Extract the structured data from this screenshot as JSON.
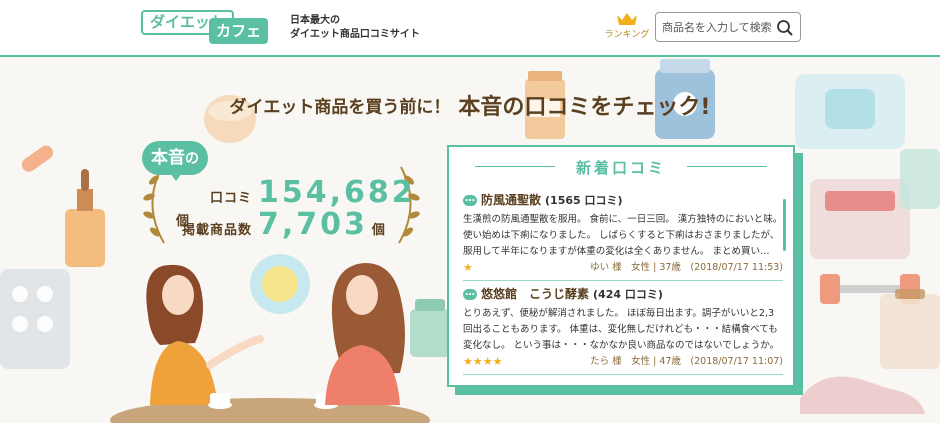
{
  "header": {
    "logo_part1": "ダイエット",
    "logo_part2": "カフェ",
    "tagline_line1": "日本最大の",
    "tagline_line2": "ダイエット商品口コミサイト",
    "ranking_label": "ランキング",
    "search_placeholder": "商品名を入力して検索"
  },
  "hero": {
    "catch_small": "ダイエット商品を買う前に！",
    "catch_large": "本音の口コミをチェック!",
    "bubble_big": "本音",
    "bubble_small": "の",
    "stats": [
      {
        "label": "口コミ",
        "value": "154,682",
        "unit": "個"
      },
      {
        "label": "掲載商品数",
        "value": "7,703",
        "unit": "個"
      }
    ]
  },
  "reviews": {
    "title": "新着口コミ",
    "items": [
      {
        "product": "防風通聖散",
        "count": "(1565 口コミ)",
        "body": "生漢煎の防風通聖散を服用。 食前に、一日三回。 漢方独特のにおいと味。 使い始めは下痢になりました。 しばらくすると下痢はおさまりましたが、服用して半年になりますが体重の変化は全くありません。 まとめ買い…",
        "stars": "★",
        "rating": 1,
        "author": "ゆい 様　女性 | 37歳　(2018/07/17 11:53)"
      },
      {
        "product": "悠悠館　こうじ酵素",
        "count": "(424 口コミ)",
        "body": "とりあえず、便秘が解消されました。 ほぼ毎日出ます。調子がいいと2,3回出ることもあります。 体重は、変化無しだけれども・・・結構食べても変化なし。 という事は・・・なかなか良い商品なのではないでしょうか。",
        "stars": "★★★★",
        "rating": 4,
        "author": "たら 様　女性 | 47歳　(2018/07/17 11:07)"
      }
    ]
  },
  "colors": {
    "accent": "#5bbfa3",
    "brown": "#5a4020",
    "star": "#f2b01e",
    "gold": "#b38a1c"
  }
}
